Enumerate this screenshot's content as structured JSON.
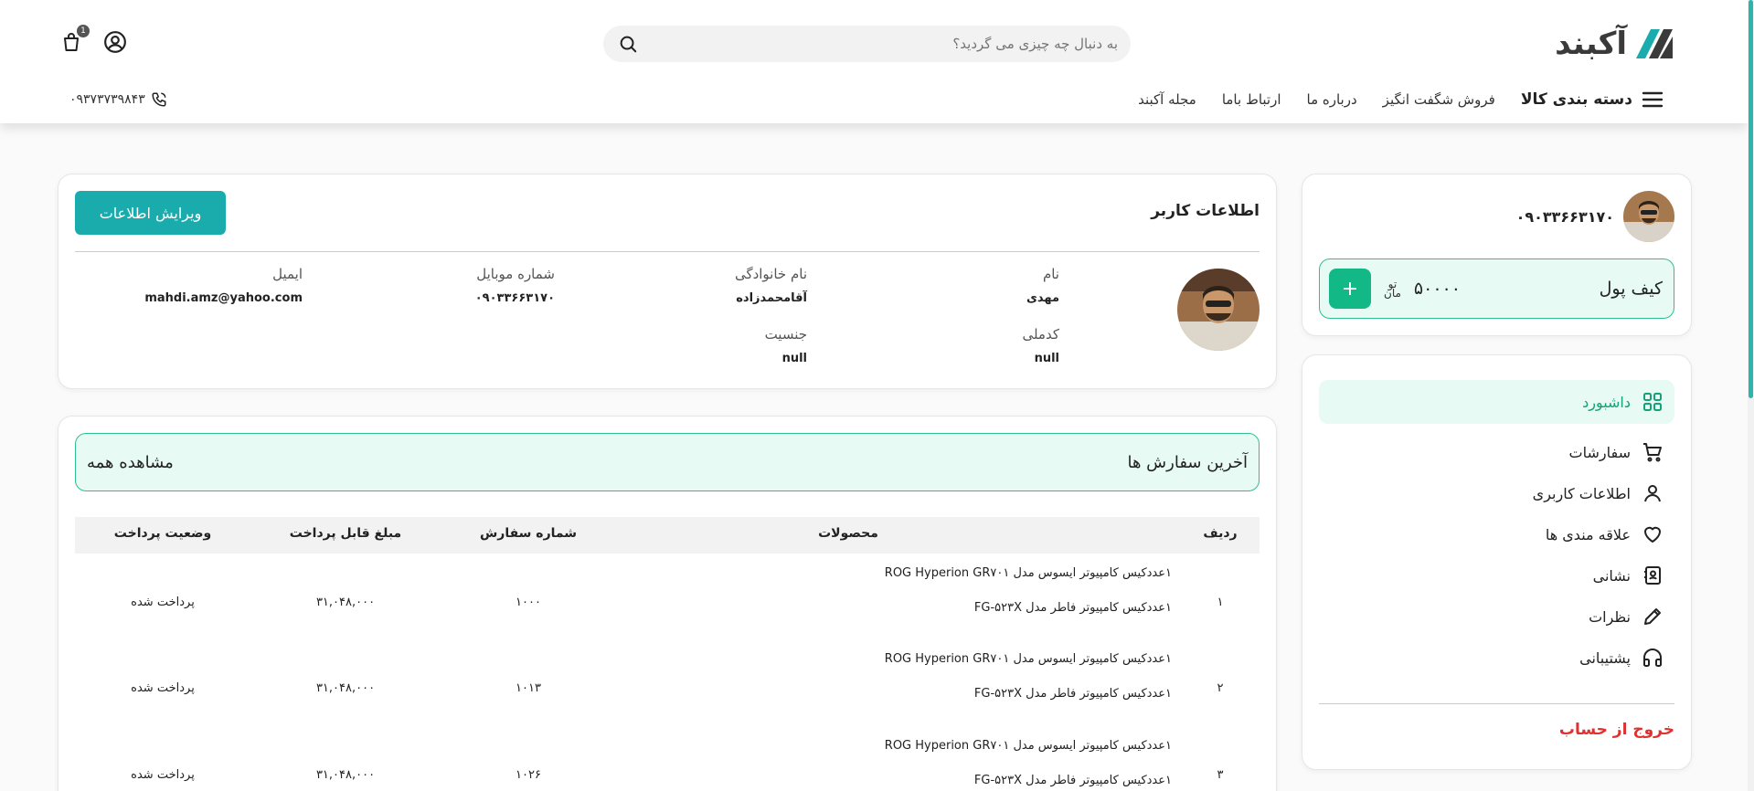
{
  "header": {
    "logo_text": "آکبند",
    "search_placeholder": "به دنبال چه چیزی می گردید؟",
    "cart_count": "1",
    "category_label": "دسته بندی کالا",
    "nav_links": [
      "فروش شگفت انگیز",
      "درباره ما",
      "ارتباط باما",
      "مجله آکبند"
    ],
    "phone": "۰۹۳۷۳۷۳۹۸۴۳"
  },
  "profile": {
    "phone": "۰۹۰۳۳۶۶۳۱۷۰",
    "wallet_label": "کیف پول",
    "wallet_amount": "۵۰۰۰۰",
    "wallet_currency_top": "تو",
    "wallet_currency_bottom": "مان",
    "wallet_add": "+"
  },
  "menu": {
    "items": [
      {
        "label": "داشبورد",
        "icon": "grid-icon",
        "active": true
      },
      {
        "label": "سفارشات",
        "icon": "cart-icon"
      },
      {
        "label": "اطلاعات کاربری",
        "icon": "user-icon"
      },
      {
        "label": "علاقه مندی ها",
        "icon": "heart-icon"
      },
      {
        "label": "نشانی",
        "icon": "address-book-icon"
      },
      {
        "label": "نظرات",
        "icon": "pencil-icon"
      },
      {
        "label": "پشتیبانی",
        "icon": "headphones-icon"
      }
    ],
    "logout": "خروج از حساب"
  },
  "user_info": {
    "title": "اطلاعات کاربر",
    "edit_button": "ویرایش اطلاعات",
    "fields": {
      "first_name": {
        "label": "نام",
        "value": "مهدی"
      },
      "last_name": {
        "label": "نام خانوادگی",
        "value": "آقامحمدزاده"
      },
      "mobile": {
        "label": "شماره موبایل",
        "value": "۰۹۰۳۳۶۶۳۱۷۰"
      },
      "email": {
        "label": "ایمیل",
        "value": "mahdi.amz@yahoo.com"
      },
      "national_code": {
        "label": "کدملی",
        "value": "null"
      },
      "gender": {
        "label": "جنسیت",
        "value": "null"
      }
    }
  },
  "orders": {
    "title": "آخرین سفارش ها",
    "view_all": "مشاهده همه",
    "columns": {
      "index": "ردیف",
      "products": "محصولات",
      "order_number": "شماره سفارش",
      "amount": "مبلغ قابل پرداخت",
      "status": "وضعیت پرداخت"
    },
    "rows": [
      {
        "index": "۱",
        "products": [
          "۱عددکیس کامپیوتر ایسوس مدل ROG Hyperion GR۷۰۱",
          "۱عددکیس کامپیوتر فاطر مدل FG-۵۲۳X"
        ],
        "order_number": "۱۰۰۰",
        "amount": "۳۱,۰۴۸,۰۰۰",
        "status": "پرداخت شده"
      },
      {
        "index": "۲",
        "products": [
          "۱عددکیس کامپیوتر ایسوس مدل ROG Hyperion GR۷۰۱",
          "۱عددکیس کامپیوتر فاطر مدل FG-۵۲۳X"
        ],
        "order_number": "۱۰۱۳",
        "amount": "۳۱,۰۴۸,۰۰۰",
        "status": "پرداخت شده"
      },
      {
        "index": "۳",
        "products": [
          "۱عددکیس کامپیوتر ایسوس مدل ROG Hyperion GR۷۰۱",
          "۱عددکیس کامپیوتر فاطر مدل FG-۵۲۳X"
        ],
        "order_number": "۱۰۲۶",
        "amount": "۳۱,۰۴۸,۰۰۰",
        "status": "پرداخت شده"
      }
    ]
  },
  "colors": {
    "accent": "#12b886",
    "teal_button": "#1aacac",
    "logout": "#e03131",
    "light_green_bg": "#e7faf3"
  }
}
